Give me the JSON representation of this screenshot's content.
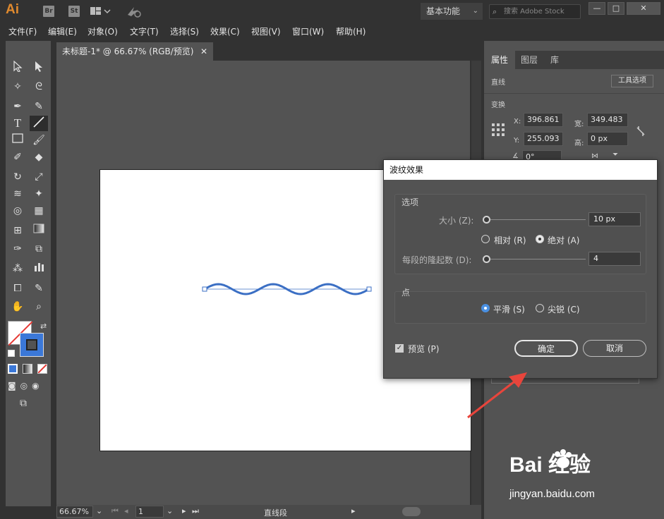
{
  "app": {
    "logo": "Ai",
    "badges": [
      "Br",
      "St"
    ],
    "workspace": "基本功能",
    "search_placeholder": "搜索 Adobe Stock",
    "window_controls": [
      "—",
      "□",
      "✕"
    ]
  },
  "menu": [
    "文件(F)",
    "编辑(E)",
    "对象(O)",
    "文字(T)",
    "选择(S)",
    "效果(C)",
    "视图(V)",
    "窗口(W)",
    "帮助(H)"
  ],
  "document": {
    "tab_title": "未标题-1* @ 66.67% (RGB/预览)",
    "close": "✕"
  },
  "statusbar": {
    "zoom": "66.67%",
    "page": "1",
    "tool": "直线段"
  },
  "properties": {
    "tabs": [
      "属性",
      "图层",
      "库"
    ],
    "section": "直线",
    "tool_options": "工具选项",
    "transform": "变换",
    "x_label": "X:",
    "x_value": "396.861",
    "y_label": "Y:",
    "y_value": "255.093",
    "w_label": "宽:",
    "w_value": "349.483",
    "h_label": "高:",
    "h_value": "0 px",
    "angle_value": "0°"
  },
  "dialog": {
    "title": "波纹效果",
    "options_group": "选项",
    "size_label": "大小 (Z):",
    "size_value": "10 px",
    "size_fraction": 0.04,
    "relative_label": "相对 (R)",
    "absolute_label": "绝对 (A)",
    "ridges_label": "每段的隆起数 (D):",
    "ridges_value": "4",
    "ridges_fraction": 0.04,
    "points_group": "点",
    "smooth_label": "平滑 (S)",
    "corner_label": "尖锐 (C)",
    "preview_label": "预览 (P)",
    "ok_label": "确定",
    "cancel_label": "取消"
  },
  "watermark": {
    "brand": "Bai 经验",
    "url": "jingyan.baidu.com"
  },
  "colors": {
    "wave": "#3b6fc4",
    "accent": "#4a90e2",
    "arrow": "#e8453c",
    "logo": "#e08a2e"
  }
}
